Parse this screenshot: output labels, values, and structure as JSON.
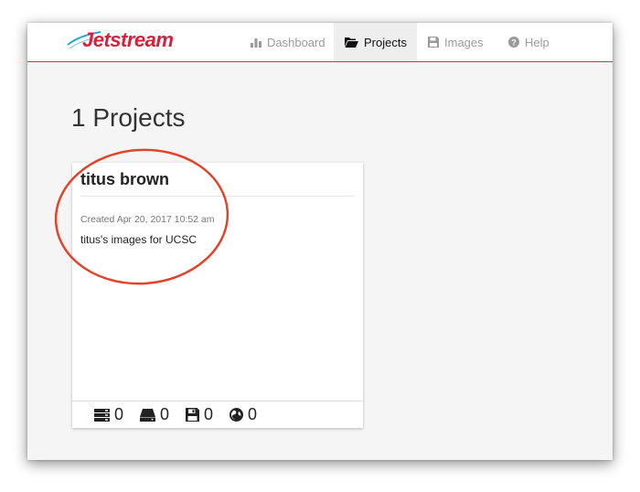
{
  "app": {
    "logo_text": "Jetstream",
    "brand_color": "#d8203a"
  },
  "nav": {
    "items": [
      {
        "label": "Dashboard",
        "icon": "bar-chart-icon",
        "active": false
      },
      {
        "label": "Projects",
        "icon": "folder-open-icon",
        "active": true
      },
      {
        "label": "Images",
        "icon": "floppy-disk-icon",
        "active": false
      },
      {
        "label": "Help",
        "icon": "question-circle-icon",
        "active": false
      }
    ]
  },
  "page": {
    "title": "1 Projects"
  },
  "project": {
    "name": "titus brown",
    "created": "Created Apr 20, 2017 10:52 am",
    "description": "titus's images for UCSC",
    "stats": [
      {
        "icon": "server-stack-icon",
        "value": "0"
      },
      {
        "icon": "hard-drive-icon",
        "value": "0"
      },
      {
        "icon": "floppy-disk-icon",
        "value": "0"
      },
      {
        "icon": "globe-icon",
        "value": "0"
      }
    ]
  },
  "annotation": {
    "color": "#e0442a"
  }
}
